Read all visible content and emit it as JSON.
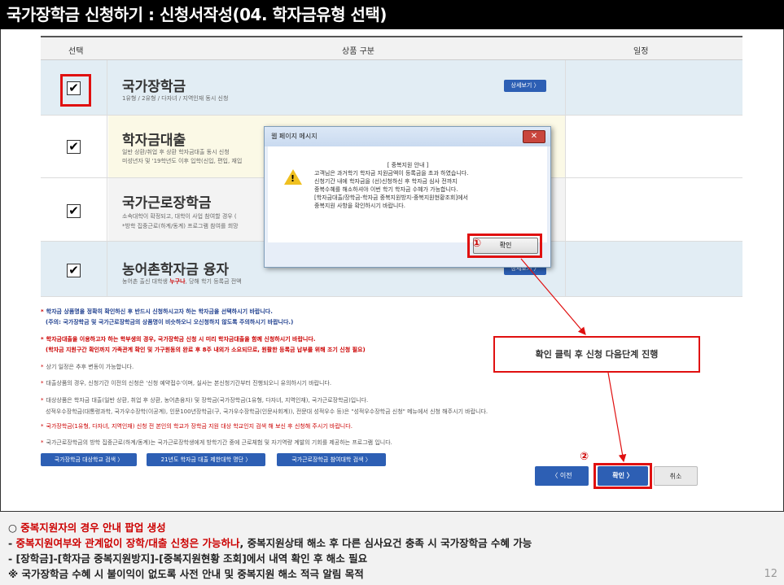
{
  "title": "국가장학금 신청하기 : 신청서작성(04. 학자금유형 선택)",
  "table": {
    "col_select": "선택",
    "col_product": "상품 구분",
    "col_date": "일정"
  },
  "rows": [
    {
      "title": "국가장학금",
      "sub1": "1유형 / 2유형 / 다자녀 / 지역인재 동시 신청",
      "sub2": "",
      "detail": "상세보기 〉",
      "checked": "✔"
    },
    {
      "title": "학자금대출",
      "sub1": "일반 상환/취업 후 상환 학자금대출 동시 신청",
      "sub2": "미성년자 및 '19학년도 이후 입학(신입, 편입, 재입",
      "detail": "",
      "checked": "✔"
    },
    {
      "title": "국가근로장학금",
      "sub1": "소속대학이 확정되고, 대학이 사업 참여할 경우 (",
      "sub2": "*방학 집중근로(하계/동계) 프로그램 참여를 희망",
      "detail": "",
      "checked": "✔"
    },
    {
      "title": "농어촌학자금 융자",
      "sub1_pre": "농어촌 출신 대학생 ",
      "sub1_red": "누구나",
      "sub1_post": ", 당해 학기 등록금 전액",
      "detail": "상세보기 〉",
      "checked": "✔"
    }
  ],
  "notes": [
    "학자금 상품명을 정확히 확인하신 후 반드시 신청하시고자 하는 학자금을 선택하시기 바랍니다.",
    "(주의: 국가장학금 및 국가근로장학금의 상품명이 비슷하오니 오신청하지 않도록 주의하시기 바랍니다.)",
    "학자금대출을 이용하고자 하는 학부생의 경우, 국가장학금 신청 시 미리 학자금대출을 함께 신청하시기 바랍니다.",
    "(학자금 지원구간 확인까지 가족관계 확인 및 가구원동의 완료 후 8주 내외가 소요되므로, 원활한 등록금 납부를 위해 조기 신청 필요)",
    "상기 일정은 추후 변동이 가능합니다.",
    "대출상품의 경우, 신청기간 이전의 신청은 '신청 예약접수'이며, 실사는 본신청기간부터 진행되오니 유의하시기 바랍니다.",
    "대상상품은 학자금 대출(일반 상환, 취업 후 상환, 농어촌융자) 및 장학금(국가장학금(1유형, 다자녀, 지역인재), 국가근로장학금)입니다.",
    "성적우수장학금(대통령과학, 국가우수장학(이공계), 인문100년장학금(구, 국가우수장학금(인문사회계)), 전문대 성적우수 등)은 \"성적우수장학금 신청\" 메뉴에서 신청 해주시기 바랍니다.",
    "국가장학금(1유형, 다자녀, 지역인재) 신청 전 본인의 학교가 장학금 지원 대상 학교인지 검색 해 보신 후 신청해 주시기 바랍니다.",
    "국가근로장학금의 방학 집중근로(하계/동계)는 국가근로장학생에게 방학기간 중에 근로체험 및 자기역량 계발의 기회를 제공하는 프로그램 입니다."
  ],
  "links": {
    "school_search": "국가장학금 대상학교 검색 〉",
    "loan_limit": "21년도 학자금 대출 제한대학 명단 〉",
    "work_school": "국가근로장학금 참여대학 검색 〉"
  },
  "nav": {
    "prev": "〈 이전",
    "confirm": "확인 〉",
    "cancel": "취소"
  },
  "dialog": {
    "title": "웹 페이지 메시지",
    "close": "✕",
    "line0": "[ 중복지원 안내 ]",
    "line1": "고객님은 과거학기 학자금 지원금액이 등록금을 초과 하였습니다.",
    "line2": "신청기간 내에 학자금을 (선)신청하신 후 학자금 심사 전까지",
    "line3": "중복수혜를 해소하셔야 이번 학기 학자금 수혜가 가능합니다.",
    "line4": "[학자금대출/장학금-학자금 중복지원방지-중복지원현황조회]에서",
    "line5": "중복지원 사항을 확인하시기 바랍니다.",
    "ok": "확인",
    "warn_mark": "!"
  },
  "markers": {
    "one": "①",
    "two": "②"
  },
  "callout": "확인 클릭 후 신청 다음단계 진행",
  "bottom": {
    "l1_circle": "○ ",
    "l1": "중복지원자의 경우 안내 팝업 생성",
    "l2_a": " - ",
    "l2_b": "중복지원여부와 관계없이 장학/대출 신청은 가능하나",
    "l2_c": ", 중복지원상태 해소 후 다른 심사요건 충족 시 국가장학금 수혜 가능",
    "l3": " - [장학금]-[학자금 중복지원방지]-[중복지원현황 조회]에서 내역 확인 후 해소 필요",
    "l4": " ※ 국가장학금 수혜 시 불이익이 없도록 사전 안내 및 중복지원 해소 적극 알림 목적"
  },
  "page_number": "12",
  "colors": {
    "accent": "#2d5fb4",
    "highlight": "#e01010"
  }
}
